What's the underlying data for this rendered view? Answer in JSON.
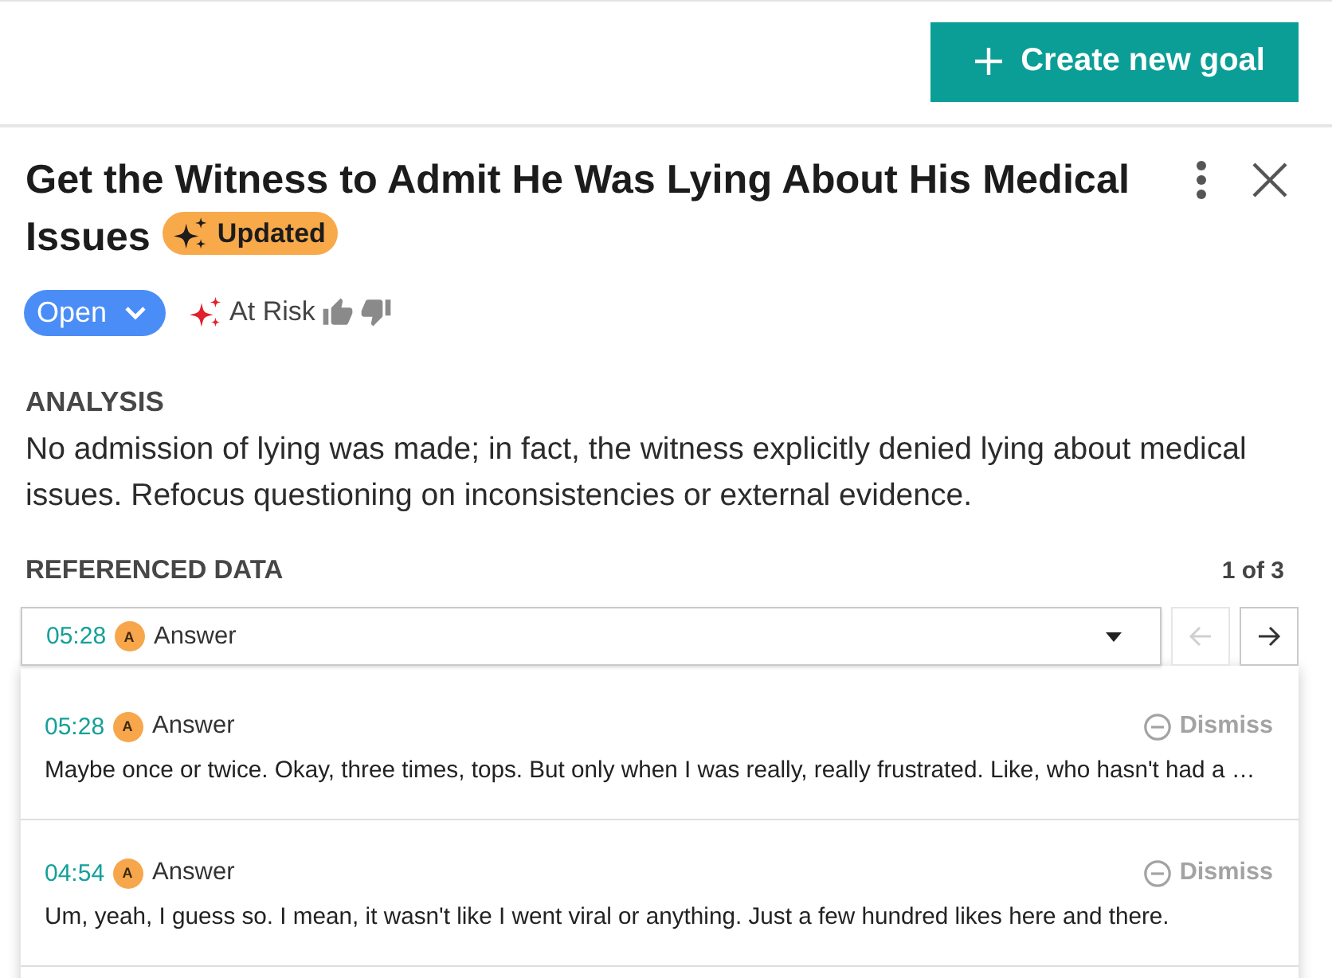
{
  "header": {
    "create_button": {
      "label": "Create new goal"
    }
  },
  "goal": {
    "title": "Get the Witness to Admit He Was Lying About His Medical Issues",
    "badge": {
      "label": "Updated"
    },
    "status": {
      "label": "Open"
    },
    "risk": {
      "label": "At Risk"
    }
  },
  "analysis": {
    "heading": "ANALYSIS",
    "text": "No admission of lying was made; in fact, the witness explicitly denied lying about medical issues. Refocus questioning on inconsistencies or external evidence."
  },
  "referenced_data": {
    "heading": "REFERENCED DATA",
    "counter": "1 of 3",
    "selector": {
      "time": "05:28",
      "speaker_initial": "A",
      "speaker": "Answer",
      "expanded": true
    },
    "prev_button": {
      "disabled": true
    },
    "next_button": {
      "disabled": false
    },
    "items": [
      {
        "time": "05:28",
        "speaker_initial": "A",
        "speaker": "Answer",
        "dismiss": "Dismiss",
        "text": "Maybe once or twice. Okay, three times, tops. But only when I was really, really frustrated. Like, who hasn't had a …"
      },
      {
        "time": "04:54",
        "speaker_initial": "A",
        "speaker": "Answer",
        "dismiss": "Dismiss",
        "text": "Um, yeah, I guess so. I mean, it wasn't like I went viral or anything. Just a few hundred likes here and there."
      }
    ]
  }
}
